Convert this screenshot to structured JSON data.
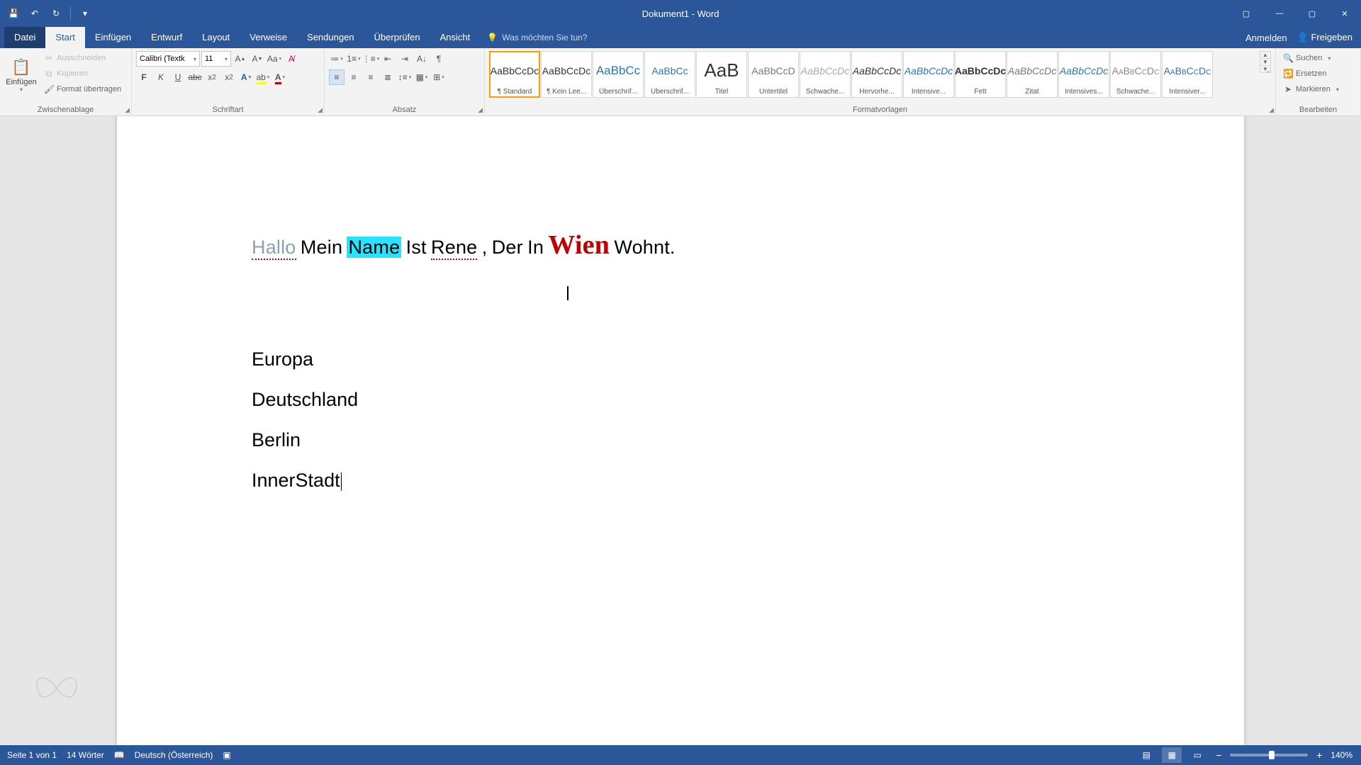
{
  "app": {
    "title": "Dokument1 - Word"
  },
  "qat": {
    "save": "💾",
    "undo": "↶",
    "redo": "↻",
    "touch": "👆"
  },
  "tabs": {
    "file": "Datei",
    "home": "Start",
    "insert": "Einfügen",
    "design": "Entwurf",
    "layout": "Layout",
    "references": "Verweise",
    "mailings": "Sendungen",
    "review": "Überprüfen",
    "view": "Ansicht",
    "tellme": "Was möchten Sie tun?",
    "signin": "Anmelden",
    "share": "Freigeben"
  },
  "ribbon": {
    "clipboard": {
      "paste": "Einfügen",
      "cut": "Ausschneiden",
      "copy": "Kopieren",
      "format_painter": "Format übertragen",
      "group": "Zwischenablage"
    },
    "font": {
      "name": "Calibri (Textk",
      "size": "11",
      "group": "Schriftart"
    },
    "paragraph": {
      "group": "Absatz"
    },
    "styles": {
      "group": "Formatvorlagen",
      "items": [
        {
          "prev": "AaBbCcDc",
          "name": "¶ Standard",
          "cls": "std"
        },
        {
          "prev": "AaBbCcDc",
          "name": "¶ Kein Lee...",
          "cls": "std"
        },
        {
          "prev": "AaBbCc",
          "name": "Überschrif...",
          "cls": "h1"
        },
        {
          "prev": "AaBbCc",
          "name": "Überschrif...",
          "cls": "h2"
        },
        {
          "prev": "AaB",
          "name": "Titel",
          "cls": "title"
        },
        {
          "prev": "AaBbCcD",
          "name": "Untertitel",
          "cls": "sub"
        },
        {
          "prev": "AaBbCcDc",
          "name": "Schwache...",
          "cls": "sEmph"
        },
        {
          "prev": "AaBbCcDc",
          "name": "Hervorhe...",
          "cls": "emph"
        },
        {
          "prev": "AaBbCcDc",
          "name": "Intensive...",
          "cls": "iEmph"
        },
        {
          "prev": "AaBbCcDc",
          "name": "Fett",
          "cls": "bold"
        },
        {
          "prev": "AaBbCcDc",
          "name": "Zitat",
          "cls": "quote"
        },
        {
          "prev": "AaBbCcDc",
          "name": "Intensives...",
          "cls": "iQuote"
        },
        {
          "prev": "AaBbCcDc",
          "name": "Schwache...",
          "cls": "sRef"
        },
        {
          "prev": "AaBbCcDc",
          "name": "Intensiver...",
          "cls": "iRef"
        }
      ]
    },
    "editing": {
      "find": "Suchen",
      "replace": "Ersetzen",
      "select": "Markieren",
      "group": "Bearbeiten"
    }
  },
  "document": {
    "line1": {
      "hallo": "Hallo",
      "mein": "Mein",
      "name": "Name",
      "ist": "Ist",
      "rene": "Rene",
      "comma": ",",
      "der": "Der",
      "in": "In",
      "wien": "Wien",
      "wohnt": "Wohnt."
    },
    "list": [
      "Europa",
      "Deutschland",
      "Berlin",
      "InnerStadt"
    ]
  },
  "status": {
    "page": "Seite 1 von 1",
    "words": "14 Wörter",
    "lang": "Deutsch (Österreich)",
    "zoom": "140%"
  }
}
